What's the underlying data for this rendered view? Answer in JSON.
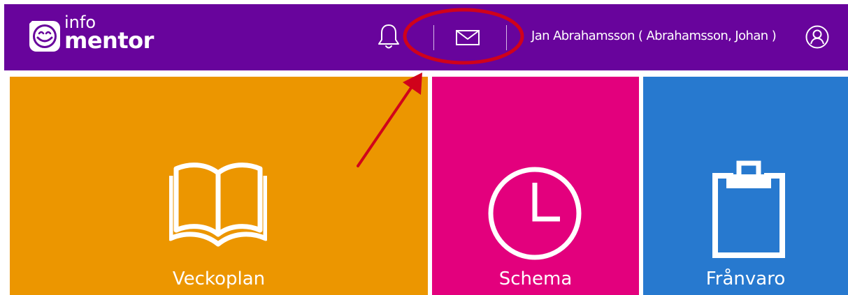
{
  "header": {
    "logo": {
      "word_top": "info",
      "word_bottom": "mentor"
    },
    "icons": {
      "notifications": "bell-icon",
      "messages": "envelope-icon",
      "profile": "user-circle-icon"
    },
    "user_name": "Jan Abrahamsson ( Abrahamsson, Johan )"
  },
  "tiles": [
    {
      "label": "Veckoplan",
      "icon": "book-icon",
      "color": "#ec9600"
    },
    {
      "label": "Schema",
      "icon": "clock-icon",
      "color": "#e3007d"
    },
    {
      "label": "Frånvaro",
      "icon": "clipboard-icon",
      "color": "#2779cf"
    }
  ],
  "colors": {
    "header_bg": "#68049c",
    "annotation": "#d0021b"
  }
}
